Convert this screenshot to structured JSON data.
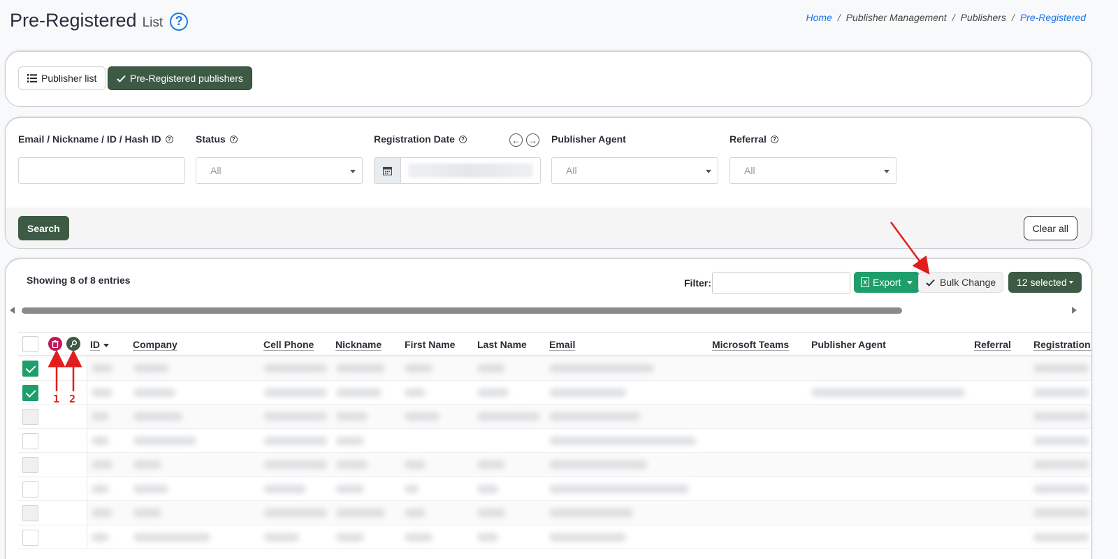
{
  "header": {
    "title": "Pre-Registered",
    "subtitle": "List",
    "help_icon": "?"
  },
  "breadcrumb": [
    "Home",
    "Publisher Management",
    "Publishers",
    "Pre-Registered"
  ],
  "tabs": [
    {
      "label": "Publisher list",
      "icon": "list-icon",
      "active": false
    },
    {
      "label": "Pre-Registered publishers",
      "icon": "check-icon",
      "active": true
    }
  ],
  "filters": {
    "email_label": "Email / Nickname / ID / Hash ID",
    "status_label": "Status",
    "status_value": "All",
    "date_label": "Registration Date",
    "agent_label": "Publisher Agent",
    "agent_value": "All",
    "referral_label": "Referral",
    "referral_value": "All",
    "q": "?"
  },
  "actions": {
    "search": "Search",
    "clear_all": "Clear all"
  },
  "table_toolbar": {
    "showing": "Showing 8 of 8 entries",
    "filter_label": "Filter:",
    "export": "Export",
    "export_icon_text": "X",
    "bulk_change": "Bulk Change",
    "selected": "12 selected"
  },
  "columns": [
    "ID",
    "Company",
    "Cell Phone",
    "Nickname",
    "First Name",
    "Last Name",
    "Email",
    "Microsoft Teams",
    "Publisher Agent",
    "Referral",
    "Registration D"
  ],
  "rows": [
    {
      "checked": true
    },
    {
      "checked": true
    },
    {
      "checked": false
    },
    {
      "checked": false
    },
    {
      "checked": false
    },
    {
      "checked": false
    },
    {
      "checked": false
    },
    {
      "checked": false
    }
  ],
  "annotations": {
    "label_1": "1",
    "label_2": "2"
  },
  "colors": {
    "accent": "#3d5a44",
    "success": "#1e9e6a",
    "danger": "#c2185b",
    "annotation": "#e21d1d"
  }
}
